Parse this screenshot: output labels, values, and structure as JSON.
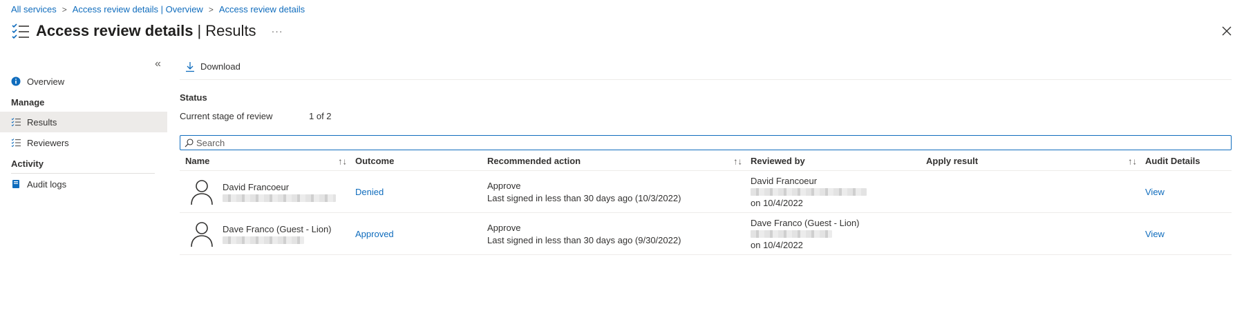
{
  "breadcrumb": {
    "items": [
      "All services",
      "Access review details | Overview",
      "Access review details"
    ]
  },
  "header": {
    "title": "Access review details",
    "separator": "|",
    "subtitle": "Results",
    "more": "···",
    "close_icon": "close-icon",
    "title_icon": "checklist-icon"
  },
  "sidebar": {
    "collapse": "«",
    "overview": "Overview",
    "manage_heading": "Manage",
    "items": [
      {
        "label": "Results",
        "icon": "list-icon",
        "active": true
      },
      {
        "label": "Reviewers",
        "icon": "list-icon",
        "active": false
      }
    ],
    "activity_heading": "Activity",
    "audit_logs": "Audit logs"
  },
  "toolbar": {
    "download_label": "Download",
    "download_icon": "download-icon"
  },
  "status": {
    "heading": "Status",
    "label": "Current stage of review",
    "value": "1 of 2"
  },
  "search": {
    "placeholder": "Search",
    "value": ""
  },
  "table": {
    "columns": [
      "Name",
      "Outcome",
      "Recommended action",
      "Reviewed by",
      "Apply result",
      "Audit Details"
    ],
    "rows": [
      {
        "name": "David Francoeur",
        "outcome": "Denied",
        "recommended": "Approve",
        "recommended_detail": "Last signed in less than 30 days ago (10/3/2022)",
        "reviewed_by": "David Francoeur",
        "reviewed_on": "on 10/4/2022",
        "apply_result": "",
        "audit": "View"
      },
      {
        "name": "Dave Franco (Guest - Lion)",
        "outcome": "Approved",
        "recommended": "Approve",
        "recommended_detail": "Last signed in less than 30 days ago (9/30/2022)",
        "reviewed_by": "Dave Franco (Guest - Lion)",
        "reviewed_on": "on 10/4/2022",
        "apply_result": "",
        "audit": "View"
      }
    ]
  },
  "colors": {
    "link": "#0f6cbd",
    "active_nav": "#edebe9",
    "info_icon": "#0f6cbd"
  }
}
